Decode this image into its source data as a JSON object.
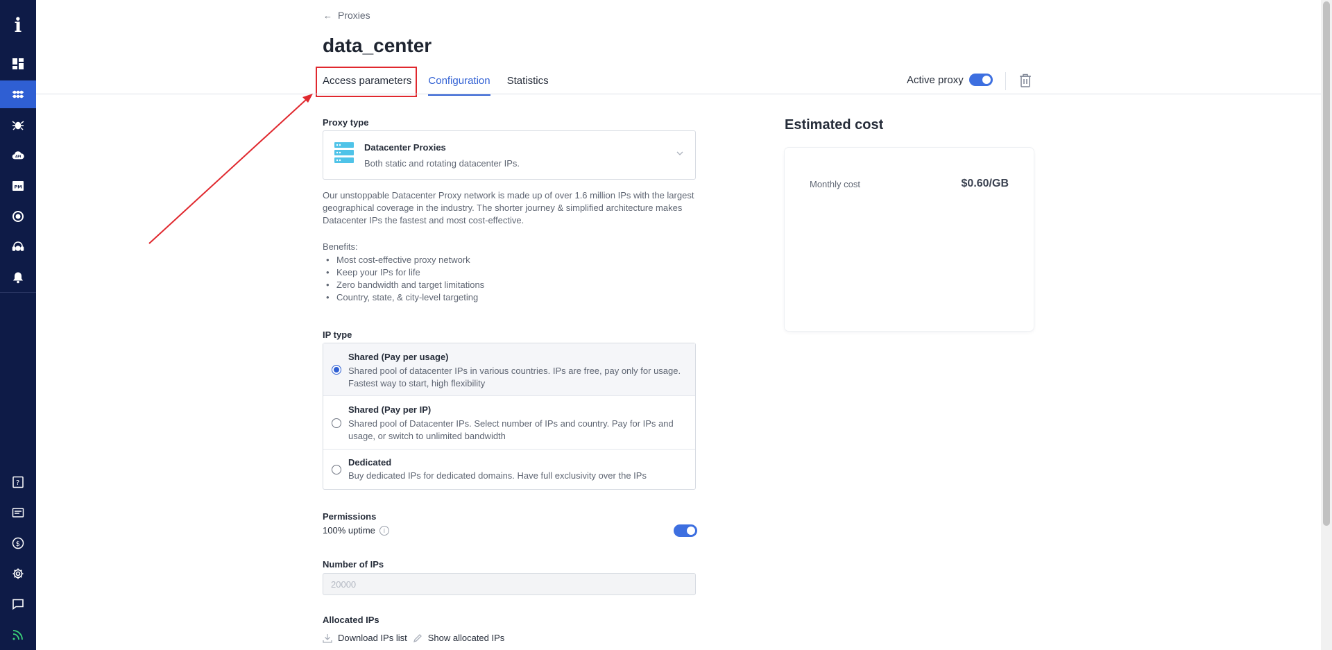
{
  "breadcrumb": {
    "back_label": "Proxies"
  },
  "page": {
    "title": "data_center"
  },
  "tabs": [
    {
      "label": "Access parameters",
      "highlighted": true
    },
    {
      "label": "Configuration",
      "active": true
    },
    {
      "label": "Statistics"
    }
  ],
  "header": {
    "active_proxy_label": "Active proxy",
    "active_proxy_on": true
  },
  "proxy_type": {
    "section_label": "Proxy type",
    "selected_title": "Datacenter Proxies",
    "selected_subtitle": "Both static and rotating datacenter IPs.",
    "description": "Our unstoppable Datacenter Proxy network is made up of over 1.6 million IPs with the largest geographical coverage in the industry. The shorter journey & simplified architecture makes Datacenter IPs the fastest and most cost-effective.",
    "benefits_title": "Benefits:",
    "benefits": [
      "Most cost-effective proxy network",
      "Keep your IPs for life",
      "Zero bandwidth and target limitations",
      "Country, state, & city-level targeting"
    ]
  },
  "ip_type": {
    "section_label": "IP type",
    "options": [
      {
        "title": "Shared (Pay per usage)",
        "desc": "Shared pool of datacenter IPs in various countries. IPs are free, pay only for usage. Fastest way to start, high flexibility",
        "selected": true
      },
      {
        "title": "Shared (Pay per IP)",
        "desc": "Shared pool of Datacenter IPs. Select number of IPs and country. Pay for IPs and usage, or switch to unlimited bandwidth",
        "selected": false
      },
      {
        "title": "Dedicated",
        "desc": "Buy dedicated IPs for dedicated domains. Have full exclusivity over the IPs",
        "selected": false
      }
    ]
  },
  "permissions": {
    "section_label": "Permissions",
    "uptime_label": "100% uptime",
    "uptime_on": true
  },
  "number_of_ips": {
    "section_label": "Number of IPs",
    "placeholder": "20000"
  },
  "allocated_ips": {
    "section_label": "Allocated IPs",
    "download_label": "Download IPs list",
    "show_label": "Show allocated IPs"
  },
  "estimate": {
    "title": "Estimated cost",
    "monthly_label": "Monthly cost",
    "monthly_value": "$0.60/GB"
  },
  "colors": {
    "sidebar": "#0e1b47",
    "accent": "#2f5fd3",
    "annotation": "#e0282e"
  }
}
